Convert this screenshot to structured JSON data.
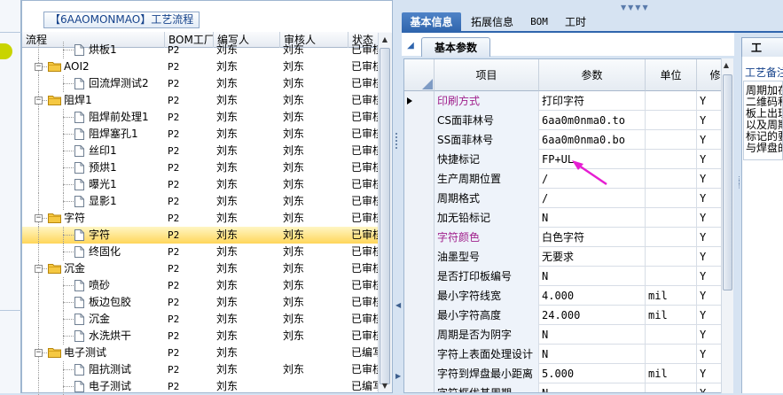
{
  "tree": {
    "title": "【6AAOMONMAO】工艺流程",
    "columns": [
      "流程",
      "BOM工厂",
      "编写人",
      "审核人",
      "状态"
    ],
    "rows": [
      {
        "level": 2,
        "kind": "doc",
        "label": "烘板1",
        "bom": "P2",
        "writer": "刘东",
        "reviewer": "刘东",
        "status": "已审核"
      },
      {
        "level": 1,
        "kind": "folder",
        "label": "AOI2",
        "bom": "P2",
        "writer": "刘东",
        "reviewer": "刘东",
        "status": "已审核"
      },
      {
        "level": 2,
        "kind": "doc",
        "label": "回流焊测试2",
        "bom": "P2",
        "writer": "刘东",
        "reviewer": "刘东",
        "status": "已审核"
      },
      {
        "level": 1,
        "kind": "folder",
        "label": "阻焊1",
        "bom": "P2",
        "writer": "刘东",
        "reviewer": "刘东",
        "status": "已审核"
      },
      {
        "level": 2,
        "kind": "doc",
        "label": "阻焊前处理1",
        "bom": "P2",
        "writer": "刘东",
        "reviewer": "刘东",
        "status": "已审核"
      },
      {
        "level": 2,
        "kind": "doc",
        "label": "阻焊塞孔1",
        "bom": "P2",
        "writer": "刘东",
        "reviewer": "刘东",
        "status": "已审核"
      },
      {
        "level": 2,
        "kind": "doc",
        "label": "丝印1",
        "bom": "P2",
        "writer": "刘东",
        "reviewer": "刘东",
        "status": "已审核"
      },
      {
        "level": 2,
        "kind": "doc",
        "label": "预烘1",
        "bom": "P2",
        "writer": "刘东",
        "reviewer": "刘东",
        "status": "已审核"
      },
      {
        "level": 2,
        "kind": "doc",
        "label": "曝光1",
        "bom": "P2",
        "writer": "刘东",
        "reviewer": "刘东",
        "status": "已审核"
      },
      {
        "level": 2,
        "kind": "doc",
        "label": "显影1",
        "bom": "P2",
        "writer": "刘东",
        "reviewer": "刘东",
        "status": "已审核"
      },
      {
        "level": 1,
        "kind": "folder",
        "label": "字符",
        "bom": "P2",
        "writer": "刘东",
        "reviewer": "刘东",
        "status": "已审核"
      },
      {
        "level": 2,
        "kind": "doc",
        "label": "字符",
        "bom": "P2",
        "writer": "刘东",
        "reviewer": "刘东",
        "status": "已审核",
        "selected": true
      },
      {
        "level": 2,
        "kind": "doc",
        "label": "终固化",
        "bom": "P2",
        "writer": "刘东",
        "reviewer": "刘东",
        "status": "已审核"
      },
      {
        "level": 1,
        "kind": "folder",
        "label": "沉金",
        "bom": "P2",
        "writer": "刘东",
        "reviewer": "刘东",
        "status": "已审核"
      },
      {
        "level": 2,
        "kind": "doc",
        "label": "喷砂",
        "bom": "P2",
        "writer": "刘东",
        "reviewer": "刘东",
        "status": "已审核"
      },
      {
        "level": 2,
        "kind": "doc",
        "label": "板边包胶",
        "bom": "P2",
        "writer": "刘东",
        "reviewer": "刘东",
        "status": "已审核"
      },
      {
        "level": 2,
        "kind": "doc",
        "label": "沉金",
        "bom": "P2",
        "writer": "刘东",
        "reviewer": "刘东",
        "status": "已审核"
      },
      {
        "level": 2,
        "kind": "doc",
        "label": "水洗烘干",
        "bom": "P2",
        "writer": "刘东",
        "reviewer": "刘东",
        "status": "已审核"
      },
      {
        "level": 1,
        "kind": "folder",
        "label": "电子测试",
        "bom": "P2",
        "writer": "刘东",
        "reviewer": "",
        "status": "已编写"
      },
      {
        "level": 2,
        "kind": "doc",
        "label": "阻抗测试",
        "bom": "P2",
        "writer": "刘东",
        "reviewer": "刘东",
        "status": "已审核"
      },
      {
        "level": 2,
        "kind": "doc",
        "label": "电子测试",
        "bom": "P2",
        "writer": "刘东",
        "reviewer": "",
        "status": "已编写"
      }
    ]
  },
  "tabs": [
    "基本信息",
    "拓展信息",
    "BOM",
    "工时"
  ],
  "subtab": "基本参数",
  "grid": {
    "columns": [
      "项目",
      "参数",
      "单位",
      "修"
    ],
    "rows": [
      {
        "name": "印刷方式",
        "value": "打印字符",
        "unit": "",
        "flag": "Y",
        "highlight": true,
        "current": true
      },
      {
        "name": "CS面菲林号",
        "value": "6aa0m0nma0.to",
        "unit": "",
        "flag": "Y"
      },
      {
        "name": "SS面菲林号",
        "value": "6aa0m0nma0.bo",
        "unit": "",
        "flag": "Y"
      },
      {
        "name": "快捷标记",
        "value": "FP+UL",
        "unit": "",
        "flag": "Y"
      },
      {
        "name": "生产周期位置",
        "value": "/",
        "unit": "",
        "flag": "Y"
      },
      {
        "name": "周期格式",
        "value": "/",
        "unit": "",
        "flag": "Y"
      },
      {
        "name": "加无铅标记",
        "value": "N",
        "unit": "",
        "flag": "Y"
      },
      {
        "name": "字符颜色",
        "value": "白色字符",
        "unit": "",
        "flag": "Y",
        "highlight": true
      },
      {
        "name": "油墨型号",
        "value": "无要求",
        "unit": "",
        "flag": "Y"
      },
      {
        "name": "是否打印板编号",
        "value": "N",
        "unit": "",
        "flag": "Y"
      },
      {
        "name": "最小字符线宽",
        "value": "4.000",
        "unit": "mil",
        "flag": "Y"
      },
      {
        "name": "最小字符高度",
        "value": "24.000",
        "unit": "mil",
        "flag": "Y"
      },
      {
        "name": "周期是否为阴字",
        "value": "N",
        "unit": "",
        "flag": "Y"
      },
      {
        "name": "字符上表面处理设计",
        "value": "N",
        "unit": "",
        "flag": "Y"
      },
      {
        "name": "字符到焊盘最小距离",
        "value": "5.000",
        "unit": "mil",
        "flag": "Y"
      },
      {
        "name": "字符框优基周期",
        "value": "N",
        "unit": "",
        "flag": "Y"
      }
    ]
  },
  "right_panel": {
    "tab": "工",
    "label": "工艺备注",
    "lines": [
      "周期加在",
      "二维码和",
      "板上出现",
      "以及周期",
      "标记的要",
      "与焊盘的"
    ]
  },
  "colors": {
    "accent": "#2f65ad",
    "selected_row": "#ffd65a",
    "magenta_label": "#a0208c",
    "arrow": "#e61ed2"
  }
}
